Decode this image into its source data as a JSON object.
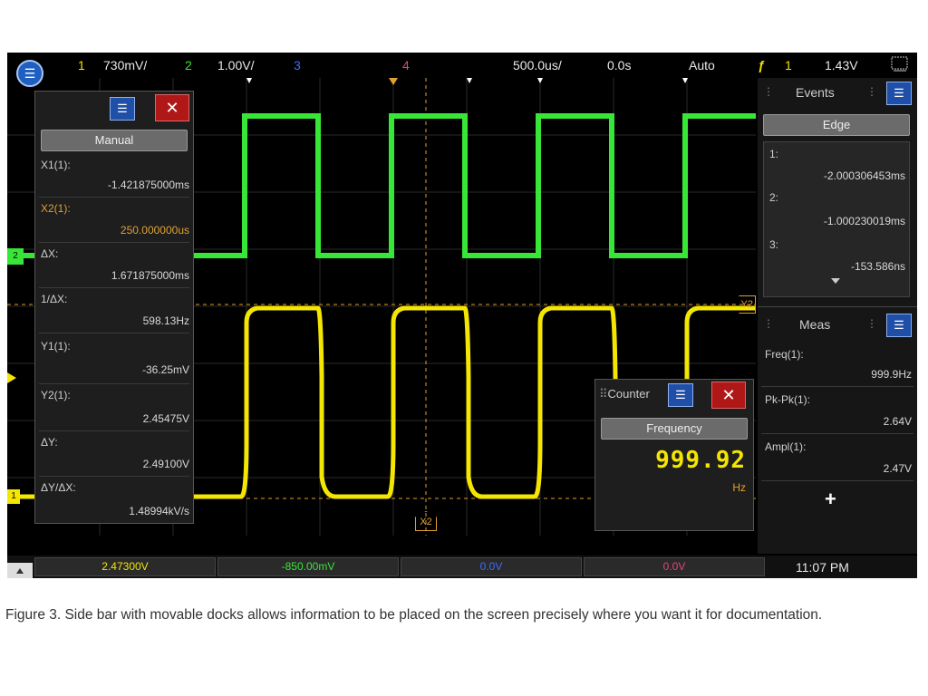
{
  "topbar": {
    "ch1_num": "1",
    "ch1_scale": "730mV/",
    "ch2_num": "2",
    "ch2_scale": "1.00V/",
    "ch3_num": "3",
    "ch4_num": "4",
    "timebase": "500.0us/",
    "delay": "0.0s",
    "trigger_mode": "Auto",
    "trigger_icon": "trigger-edge-icon",
    "trigger_source": "1",
    "trigger_level": "1.43V"
  },
  "colors": {
    "ch1": "#f4e600",
    "ch2": "#38e638",
    "ch3": "#3d6bff",
    "ch4": "#e2447c",
    "marker": "#e0a030"
  },
  "cursor_panel": {
    "mode": "Manual",
    "x1_label": "X1(1):",
    "x1_value": "-1.421875000ms",
    "x2_label": "X2(1):",
    "x2_value": "250.000000us",
    "dx_label": "ΔX:",
    "dx_value": "1.671875000ms",
    "inv_dx_label": "1/ΔX:",
    "inv_dx_value": "598.13Hz",
    "y1_label": "Y1(1):",
    "y1_value": "-36.25mV",
    "y2_label": "Y2(1):",
    "y2_value": "2.45475V",
    "dy_label": "ΔY:",
    "dy_value": "2.49100V",
    "dydx_label": "ΔY/ΔX:",
    "dydx_value": "1.48994kV/s"
  },
  "events": {
    "title": "Events",
    "type": "Edge",
    "items": [
      {
        "index": "1:",
        "value": "-2.000306453ms"
      },
      {
        "index": "2:",
        "value": "-1.000230019ms"
      },
      {
        "index": "3:",
        "value": "-153.586ns"
      }
    ]
  },
  "meas": {
    "title": "Meas",
    "items": [
      {
        "label": "Freq(1):",
        "value": "999.9Hz"
      },
      {
        "label": "Pk-Pk(1):",
        "value": "2.64V"
      },
      {
        "label": "Ampl(1):",
        "value": "2.47V"
      }
    ],
    "add": "+"
  },
  "counter": {
    "title": "Counter",
    "mode": "Frequency",
    "value": "999.92",
    "unit": "Hz"
  },
  "markers": {
    "x2": "X2",
    "y2": "Y2"
  },
  "bottombar": {
    "ch1": "2.47300V",
    "ch2": "-850.00mV",
    "ch3": "0.0V",
    "ch4": "0.0V",
    "time": "11:07 PM"
  },
  "caption": "Figure 3. Side bar with movable docks allows information to be placed on the screen precisely where you want it for documentation."
}
